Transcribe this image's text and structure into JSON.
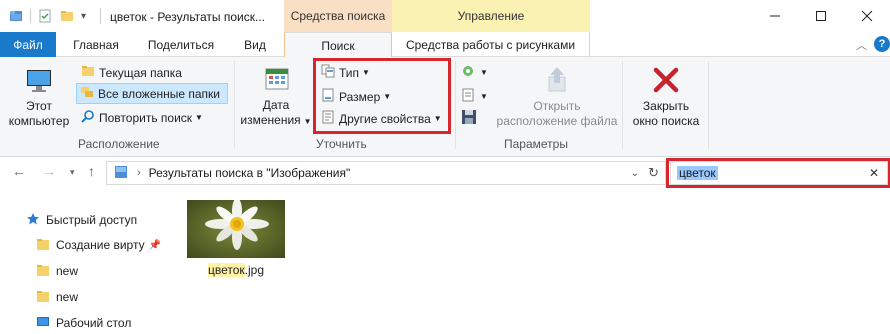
{
  "window": {
    "title": "цветок - Результаты поиск...",
    "context_tabs": [
      "Средства поиска",
      "Управление"
    ],
    "controls": [
      "minimize",
      "maximize",
      "close"
    ]
  },
  "tabs": {
    "file": "Файл",
    "home": "Главная",
    "share": "Поделиться",
    "view": "Вид",
    "search": "Поиск",
    "picture_tools": "Средства работы с рисунками"
  },
  "ribbon": {
    "location": {
      "label": "Расположение",
      "this_pc_line1": "Этот",
      "this_pc_line2": "компьютер",
      "current_folder": "Текущая папка",
      "all_subfolders": "Все вложенные папки",
      "search_again": "Повторить поиск"
    },
    "refine": {
      "label": "Уточнить",
      "date_modified_line1": "Дата",
      "date_modified_line2": "изменения",
      "type": "Тип",
      "size": "Размер",
      "other_properties": "Другие свойства"
    },
    "options": {
      "label": "Параметры",
      "open_location_line1": "Открыть",
      "open_location_line2": "расположение файла"
    },
    "close": {
      "line1": "Закрыть",
      "line2": "окно поиска"
    }
  },
  "address": {
    "path": "Результаты поиска в \"Изображения\"",
    "search_query": "цветок"
  },
  "nav": {
    "quick_access": "Быстрый доступ",
    "items": [
      "Создание вирту",
      "new",
      "new",
      "Рабочий стол"
    ]
  },
  "files": [
    {
      "name_highlight": "цветок",
      "name_rest": ".jpg"
    }
  ],
  "colors": {
    "file_tab": "#1979ca",
    "search_ctx": "#f9e0c5",
    "manage_ctx": "#f9f2b3",
    "annotation_red": "#d6262e",
    "selection": "#cce8ff"
  }
}
